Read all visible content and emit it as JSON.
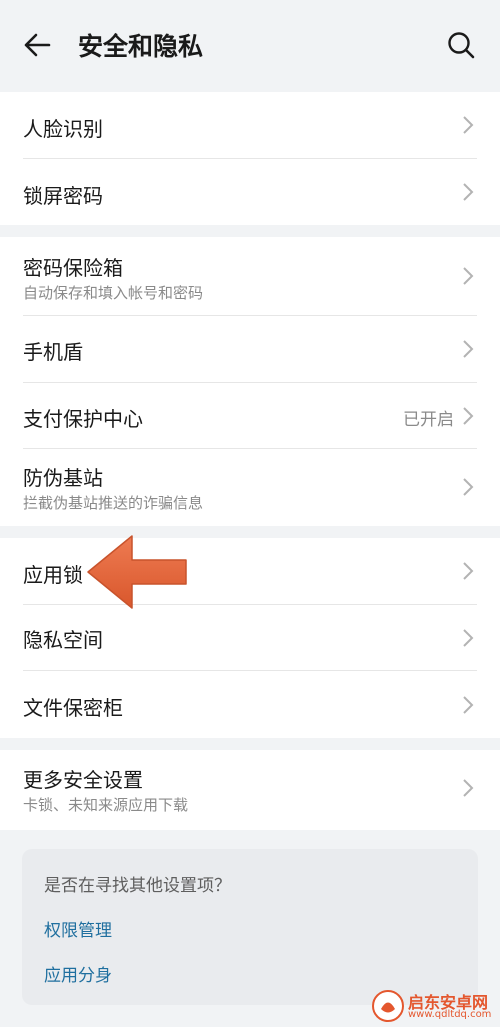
{
  "header": {
    "title": "安全和隐私"
  },
  "cards": [
    {
      "items": [
        {
          "label": "人脸识别"
        },
        {
          "label": "锁屏密码"
        }
      ]
    },
    {
      "items": [
        {
          "label": "密码保险箱",
          "sub": "自动保存和填入帐号和密码"
        },
        {
          "label": "手机盾"
        },
        {
          "label": "支付保护中心",
          "value": "已开启"
        },
        {
          "label": "防伪基站",
          "sub": "拦截伪基站推送的诈骗信息"
        }
      ]
    },
    {
      "items": [
        {
          "label": "应用锁"
        },
        {
          "label": "隐私空间"
        },
        {
          "label": "文件保密柜"
        }
      ]
    },
    {
      "items": [
        {
          "label": "更多安全设置",
          "sub": "卡锁、未知来源应用下载"
        }
      ]
    }
  ],
  "suggest": {
    "question": "是否在寻找其他设置项？",
    "links": [
      "权限管理",
      "应用分身"
    ]
  },
  "watermark": {
    "brand": "启东安卓网",
    "url": "www.qdltdq.com"
  },
  "colors": {
    "accent": "#1f6f9f",
    "arrow": "#e0683f",
    "background": "#f1f3f5"
  }
}
